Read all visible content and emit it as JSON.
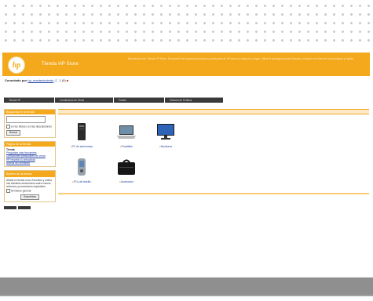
{
  "banner": {
    "logo_text": "hp",
    "store_title": "Tienda HP Store",
    "banner_text": "Bienvenido a la Tienda HP Store. Encuentre los mejores productos y accesorios de HP para su negocio y hogar. Utilice la navegacion para buscar y comprar en linea de forma segura y rapida."
  },
  "userbar": {
    "label": "Conectado por",
    "user_link": "hp_mantenimiento",
    "cart_count": "1 (0)"
  },
  "tabs": [
    {
      "label": "Tienda HP"
    },
    {
      "label": "Condiciones de Venta"
    },
    {
      "label": "Pedido"
    },
    {
      "label": "Historial de Pedidos"
    }
  ],
  "search_box": {
    "title": "Búsqueda en la tienda",
    "checkbox_label": "en los títulos y en las descripciones",
    "button_label": "Buscar"
  },
  "nav_box": {
    "title": "Página de la tienda",
    "items": [
      "Tienda",
      "Preguntas más frecuentes",
      "Condiciones particulares de venta",
      "HP respeta su privacidad",
      "Acerca del vendedor"
    ]
  },
  "newsletter": {
    "title": "Boletín de la tienda",
    "body": "Añada en tienda a sus Favoritos y reciba mis boletines electrónicos sobre nuevos artículos y promociones especiales.",
    "checkbox_label": "Mi interés general",
    "button_label": "Suscribirse"
  },
  "products": [
    {
      "label": "PC de sobremesa",
      "icon": "desktop-tower-icon"
    },
    {
      "label": "Portátiles",
      "icon": "laptop-icon"
    },
    {
      "label": "Monitores",
      "icon": "monitor-icon"
    },
    {
      "label": "PCs de bolsillo",
      "icon": "pda-icon"
    },
    {
      "label": "Accesorios",
      "icon": "bag-icon"
    }
  ],
  "colors": {
    "accent": "#f3a91b",
    "footer": "#8f8f8f",
    "tab_bg": "#3a3a3a"
  }
}
